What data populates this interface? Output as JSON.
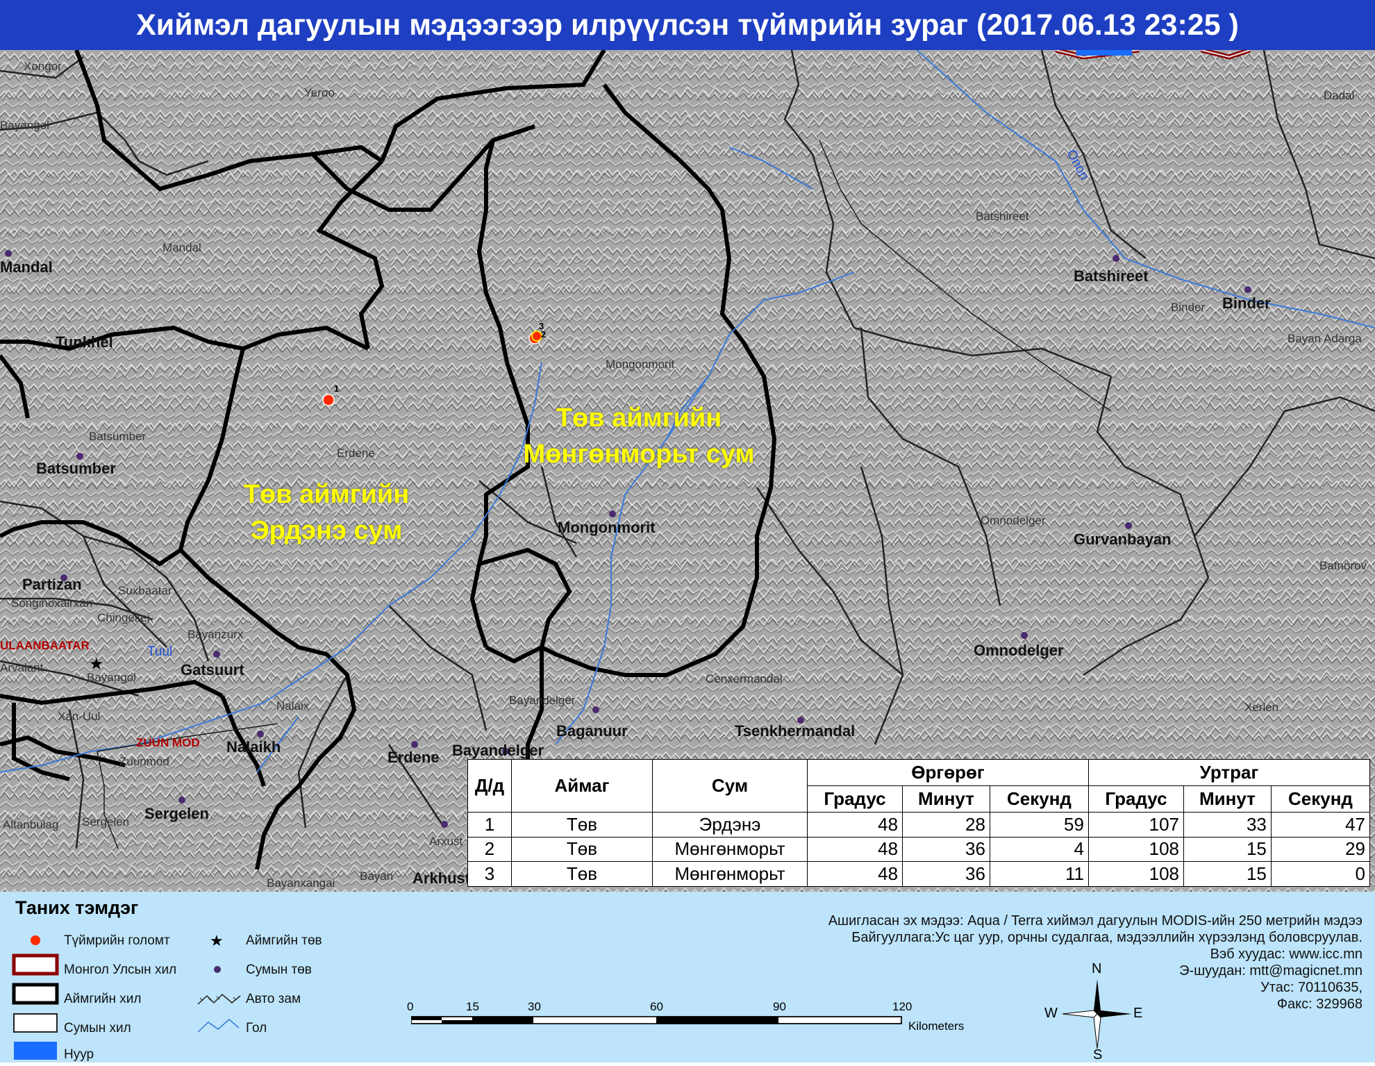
{
  "title": "Хиймэл дагуулын мэдээгээр илрүүлсэн түймрийн зураг  (2017.06.13  23:25 )",
  "map": {
    "places_small": [
      "Xongor",
      "Yeroo",
      "Bayangol",
      "Mandal",
      "Batsumber",
      "Erdene",
      "Mongonmorit",
      "Batshireet",
      "Binder",
      "Bayan Adarga",
      "Dadal",
      "Omnodelger",
      "Batnorov",
      "Songinoxairxan",
      "Suxbaatar",
      "Chingeltei",
      "Bayanzurx",
      "Arvalant",
      "Bayangol",
      "Nalaix",
      "Xan-Uul",
      "Zuunmod",
      "Cenxermandal",
      "Bayandelger",
      "Xerlen",
      "Altanbulag",
      "Sergelen",
      "Arxust",
      "Bayan",
      "Bayanxangai"
    ],
    "places_soum": [
      "Mandal",
      "Tunkhel",
      "Batsumber",
      "Partizan",
      "Gatsuurt",
      "Nalaikh",
      "Sergelen",
      "Erdene",
      "Bayandelger",
      "Baganuur",
      "Mongonmorit",
      "Tsenkhermandal",
      "Batshireet",
      "Binder",
      "Gurvanbayan",
      "Omnodelger",
      "Arkhust"
    ],
    "cities": [
      "ULAANBAATAR",
      "ZUUN MOD"
    ],
    "rivers": [
      "Onon",
      "Tuul"
    ],
    "area_labels": [
      {
        "line1": "Төв аймгийн",
        "line2": "Мөнгөнморьт сум"
      },
      {
        "line1": "Төв аймгийн",
        "line2": "Эрдэнэ сум"
      }
    ],
    "fire_points": [
      "1",
      "2",
      "3"
    ],
    "colors": {
      "fire": "#ff2a00",
      "soum_center": "#4b2a6e",
      "aimag_border": "#000000",
      "river": "#3a7ad8",
      "national_border": "#8b0000"
    }
  },
  "table": {
    "headers": {
      "no": "Д/д",
      "aimag": "Аймаг",
      "sum": "Сум",
      "lat": "Өргөрөг",
      "lon": "Уртраг",
      "deg": "Градус",
      "min": "Минут",
      "sec": "Секунд"
    },
    "rows": [
      {
        "no": "1",
        "aimag": "Төв",
        "sum": "Эрдэнэ",
        "lat_deg": "48",
        "lat_min": "28",
        "lat_sec": "59",
        "lon_deg": "107",
        "lon_min": "33",
        "lon_sec": "47"
      },
      {
        "no": "2",
        "aimag": "Төв",
        "sum": "Мөнгөнморьт",
        "lat_deg": "48",
        "lat_min": "36",
        "lat_sec": "4",
        "lon_deg": "108",
        "lon_min": "15",
        "lon_sec": "29"
      },
      {
        "no": "3",
        "aimag": "Төв",
        "sum": "Мөнгөнморьт",
        "lat_deg": "48",
        "lat_min": "36",
        "lat_sec": "11",
        "lon_deg": "108",
        "lon_min": "15",
        "lon_sec": "0"
      }
    ]
  },
  "legend": {
    "title": "Таних тэмдэг",
    "fire": "Түймрийн голомт",
    "national_border": "Монгол Улсын хил",
    "aimag_border": "Аймгийн хил",
    "soum_border": "Сумын хил",
    "lake": "Нуур",
    "aimag_center": "Аймгийн төв",
    "soum_center": "Сумын төв",
    "road": "Авто зам",
    "river": "Гол"
  },
  "info": {
    "line1": "Ашигласан эх мэдээ: Aqua / Terra хиймэл дагуулын MODIS-ийн 250 метрийн мэдээ",
    "line2": "Байгууллага:Ус цаг уур, орчны судалгаа, мэдээллийн хүрээлэнд боловсруулав.",
    "line3": "Вэб хуудас: www.icc.mn",
    "line4": "Э-шуудан: mtt@magicnet.mn",
    "line5": "Утас: 70110635,",
    "line6": "Факс: 329968"
  },
  "scale": {
    "ticks": [
      "0",
      "15",
      "30",
      "60",
      "90",
      "120"
    ],
    "unit": "Kilometers"
  },
  "compass": {
    "n": "N",
    "s": "S",
    "e": "E",
    "w": "W"
  }
}
